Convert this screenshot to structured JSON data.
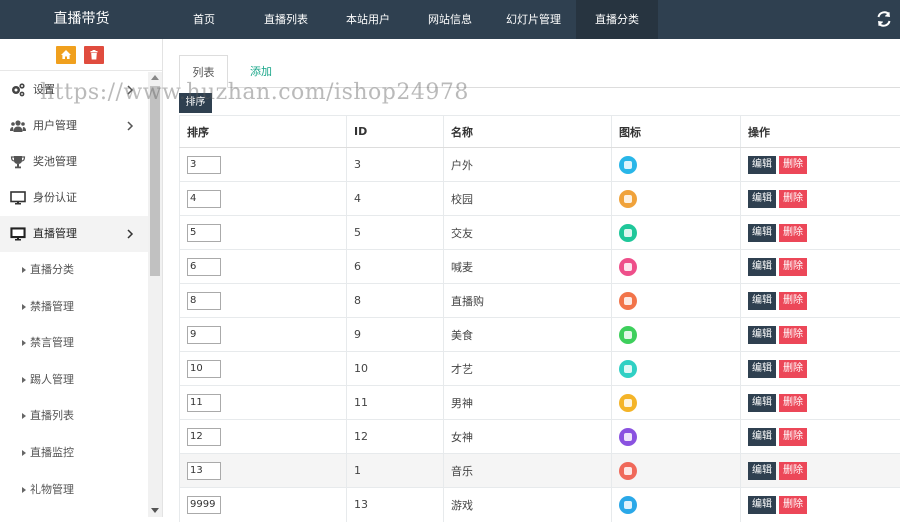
{
  "brand": "直播带货",
  "top_nav": [
    {
      "label": "首页",
      "active": false
    },
    {
      "label": "直播列表",
      "active": false
    },
    {
      "label": "本站用户",
      "active": false
    },
    {
      "label": "网站信息",
      "active": false
    },
    {
      "label": "幻灯片管理",
      "active": false
    },
    {
      "label": "直播分类",
      "active": true
    }
  ],
  "sidebar": {
    "menu": [
      {
        "label": "设置",
        "icon": "gears-icon",
        "has_children": true
      },
      {
        "label": "用户管理",
        "icon": "users-icon",
        "has_children": true
      },
      {
        "label": "奖池管理",
        "icon": "trophy-icon",
        "has_children": false
      },
      {
        "label": "身份认证",
        "icon": "desktop-icon",
        "has_children": false
      },
      {
        "label": "直播管理",
        "icon": "desktop-icon",
        "has_children": true,
        "open": true
      }
    ],
    "submenu": [
      {
        "label": "直播分类"
      },
      {
        "label": "禁播管理"
      },
      {
        "label": "禁言管理"
      },
      {
        "label": "踢人管理"
      },
      {
        "label": "直播列表"
      },
      {
        "label": "直播监控"
      },
      {
        "label": "礼物管理"
      }
    ]
  },
  "tabs": {
    "list": "列表",
    "add": "添加"
  },
  "sort_button": "排序",
  "table": {
    "headers": {
      "sort": "排序",
      "id": "ID",
      "name": "名称",
      "icon": "图标",
      "actions": "操作"
    },
    "edit_label": "编辑",
    "delete_label": "删除",
    "rows": [
      {
        "sort": "3",
        "id": "3",
        "name": "户外",
        "icon_color": "#29b6e8",
        "icon": "tent-icon"
      },
      {
        "sort": "4",
        "id": "4",
        "name": "校园",
        "icon_color": "#f0a23a",
        "icon": "graduation-cap-icon"
      },
      {
        "sort": "5",
        "id": "5",
        "name": "交友",
        "icon_color": "#1fc79a",
        "icon": "running-person-icon"
      },
      {
        "sort": "6",
        "id": "6",
        "name": "喊麦",
        "icon_color": "#ee4f8a",
        "icon": "mc-icon"
      },
      {
        "sort": "8",
        "id": "8",
        "name": "直播购",
        "icon_color": "#f2744a",
        "icon": "shopping-bag-icon"
      },
      {
        "sort": "9",
        "id": "9",
        "name": "美食",
        "icon_color": "#3ecf5c",
        "icon": "food-icon"
      },
      {
        "sort": "10",
        "id": "10",
        "name": "才艺",
        "icon_color": "#30d0c4",
        "icon": "palette-icon"
      },
      {
        "sort": "11",
        "id": "11",
        "name": "男神",
        "icon_color": "#f4b428",
        "icon": "male-icon"
      },
      {
        "sort": "12",
        "id": "12",
        "name": "女神",
        "icon_color": "#8a52e0",
        "icon": "female-icon"
      },
      {
        "sort": "13",
        "id": "1",
        "name": "音乐",
        "icon_color": "#f0695a",
        "icon": "music-icon"
      },
      {
        "sort": "9999",
        "id": "13",
        "name": "游戏",
        "icon_color": "#2aa8e8",
        "icon": "gamepad-icon"
      }
    ]
  },
  "watermark": "https://www.huzhan.com/ishop24978"
}
